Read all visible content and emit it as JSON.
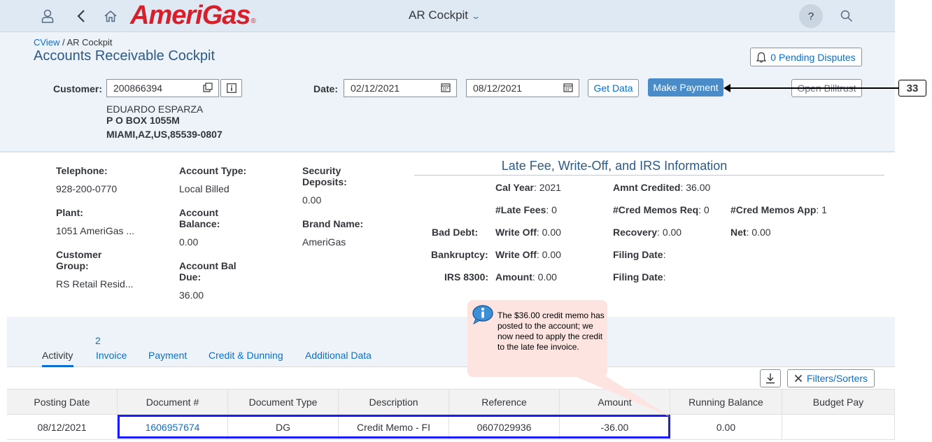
{
  "shell": {
    "logo_text": "AmeriGas",
    "logo_mark": "®",
    "title": "AR Cockpit",
    "help_label": "?"
  },
  "breadcrumb": {
    "parent": "CView",
    "separator": " / ",
    "current": "AR Cockpit"
  },
  "page_title": "Accounts Receivable Cockpit",
  "disputes_button": "0 Pending Disputes",
  "form": {
    "customer_label": "Customer:",
    "customer_value": "200866394",
    "date_label": "Date:",
    "date_from": "02/12/2021",
    "date_to": "08/12/2021",
    "get_data": "Get Data",
    "make_payment": "Make Payment",
    "open_billtrust": "Open Billtrust"
  },
  "address": {
    "name": "EDUARDO ESPARZA",
    "line1": "P O BOX 1055M",
    "line2": "MIAMI,AZ,US,85539-0807"
  },
  "callout_number": "33",
  "info": {
    "telephone_label": "Telephone:",
    "telephone": "928-200-0770",
    "plant_label": "Plant:",
    "plant": "1051 AmeriGas ...",
    "customer_group_label_1": "Customer",
    "customer_group_label_2": "Group:",
    "customer_group": "RS Retail Resid...",
    "account_type_label": "Account Type:",
    "account_type": "Local Billed",
    "account_balance_label_1": "Account",
    "account_balance_label_2": "Balance:",
    "account_balance": "0.00",
    "account_bal_due_label_1": "Account Bal",
    "account_bal_due_label_2": "Due:",
    "account_bal_due": "36.00",
    "security_deposits_label_1": "Security",
    "security_deposits_label_2": "Deposits:",
    "security_deposits": "0.00",
    "brand_name_label": "Brand Name:",
    "brand_name": "AmeriGas"
  },
  "late_fee": {
    "title": "Late Fee, Write-Off, and IRS Information",
    "cal_year_label": "Cal Year",
    "cal_year": ": 2021",
    "amnt_credited_label": "Amnt Credited",
    "amnt_credited": ": 36.00",
    "late_fees_label": "#Late Fees",
    "late_fees": ": 0",
    "cred_memos_req_label": "#Cred Memos Req",
    "cred_memos_req": ": 0",
    "cred_memos_app_label": "#Cred Memos App",
    "cred_memos_app": ": 1",
    "bad_debt_label": "Bad Debt:",
    "bad_debt_writeoff_label": "Write Off",
    "bad_debt_writeoff": ": 0.00",
    "recovery_label": "Recovery",
    "recovery": ": 0.00",
    "net_label": "Net",
    "net": ": 0.00",
    "bankruptcy_label": "Bankruptcy:",
    "bankruptcy_writeoff_label": "Write Off",
    "bankruptcy_writeoff": ": 0.00",
    "filing_date_label": "Filing Date",
    "filing_date": ":",
    "irs_label": "IRS 8300:",
    "irs_amount_label": "Amount",
    "irs_amount": ": 0.00",
    "irs_filing_date_label": "Filing Date",
    "irs_filing_date": ":"
  },
  "tabs": {
    "activity": "Activity",
    "invoice_count": "2",
    "invoice": "Invoice",
    "payment": "Payment",
    "credit_dunning": "Credit & Dunning",
    "additional_data": "Additional Data"
  },
  "toolbar": {
    "filters": "Filters/Sorters"
  },
  "table": {
    "columns": [
      "Posting Date",
      "Document #",
      "Document Type",
      "Description",
      "Reference",
      "Amount",
      "Running Balance",
      "Budget Pay"
    ],
    "rows": [
      [
        "08/12/2021",
        "1606957674",
        "DG",
        "Credit Memo - FI",
        "0607029936",
        "-36.00",
        "0.00",
        ""
      ]
    ]
  },
  "tooltip": {
    "text": "The $36.00 credit memo has posted to the account; we now need to apply the credit to the late fee invoice."
  },
  "colors": {
    "shell_bg": "#dfe9f3",
    "header_bg": "#edf3f8",
    "link": "#0a6ed1",
    "primary_button": "#4a8bc9",
    "logo": "#d81e2a",
    "highlight_box": "#1a1aff",
    "tooltip_bg": "#fde4e1"
  }
}
